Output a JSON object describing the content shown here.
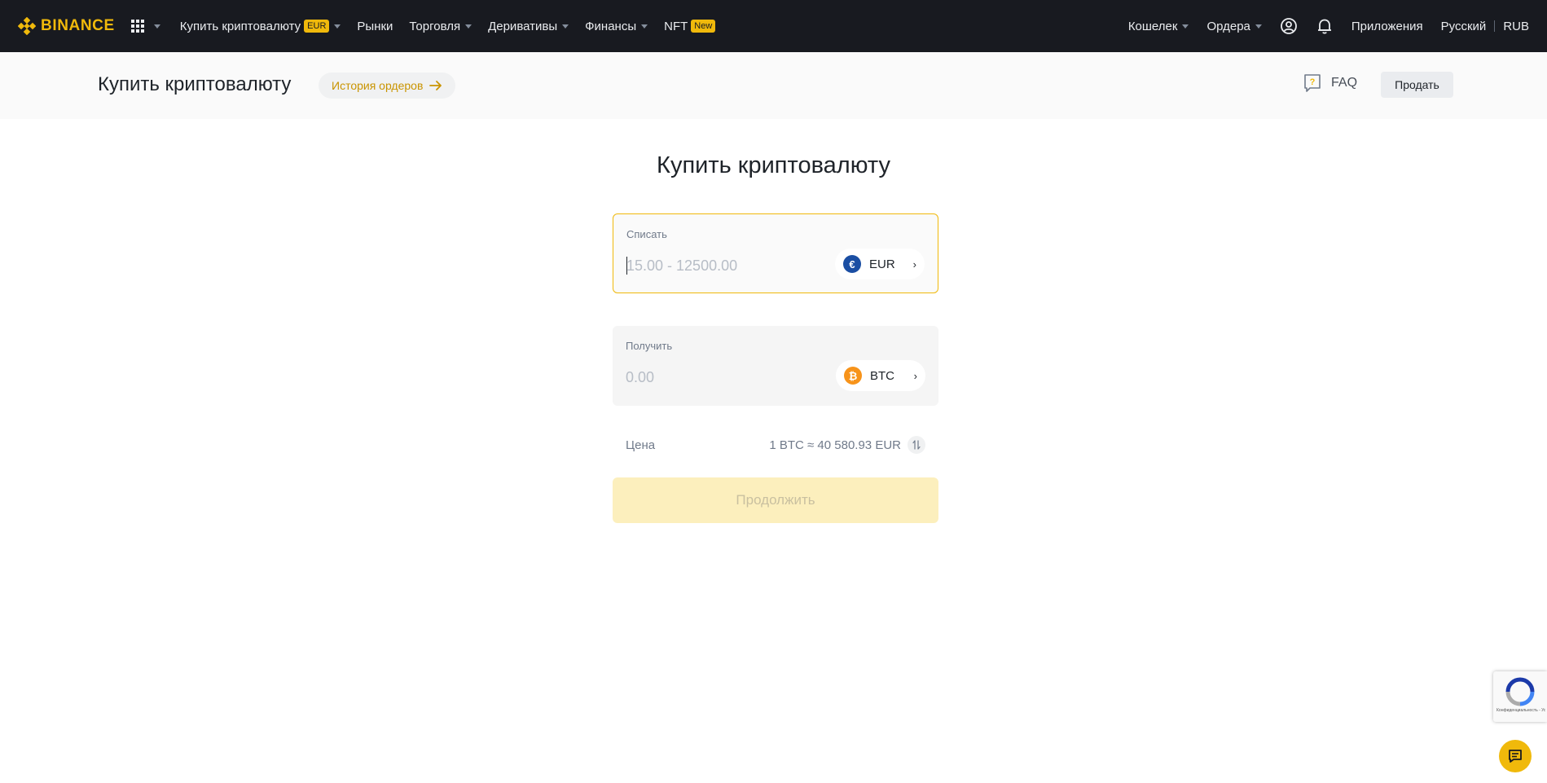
{
  "nav": {
    "logo": "BINANCE",
    "buy_crypto": "Купить криптовалюту",
    "buy_badge": "EUR",
    "markets": "Рынки",
    "trade": "Торговля",
    "derivatives": "Деривативы",
    "finance": "Финансы",
    "nft": "NFT",
    "nft_badge": "New",
    "wallet": "Кошелек",
    "orders": "Ордера",
    "apps": "Приложения",
    "language": "Русский",
    "currency": "RUB"
  },
  "subheader": {
    "title": "Купить криптовалюту",
    "history": "История ордеров",
    "faq": "FAQ",
    "sell": "Продать"
  },
  "main": {
    "title": "Купить криптовалюту",
    "spend": {
      "label": "Списать",
      "placeholder": "15.00 - 12500.00",
      "value": "",
      "currency": "EUR",
      "currency_symbol": "€"
    },
    "receive": {
      "label": "Получить",
      "placeholder": "0.00",
      "value": "",
      "currency": "BTC",
      "currency_symbol": "₿"
    },
    "price_label": "Цена",
    "price_value": "1 BTC ≈ 40 580.93 EUR",
    "continue": "Продолжить"
  },
  "recaptcha": {
    "text": "Конфиденциальность - Условия использования"
  },
  "colors": {
    "accent": "#f0b90b",
    "nav_bg": "#181a20",
    "eur_coin": "#1a4ea3",
    "btc_coin": "#f7931a"
  }
}
